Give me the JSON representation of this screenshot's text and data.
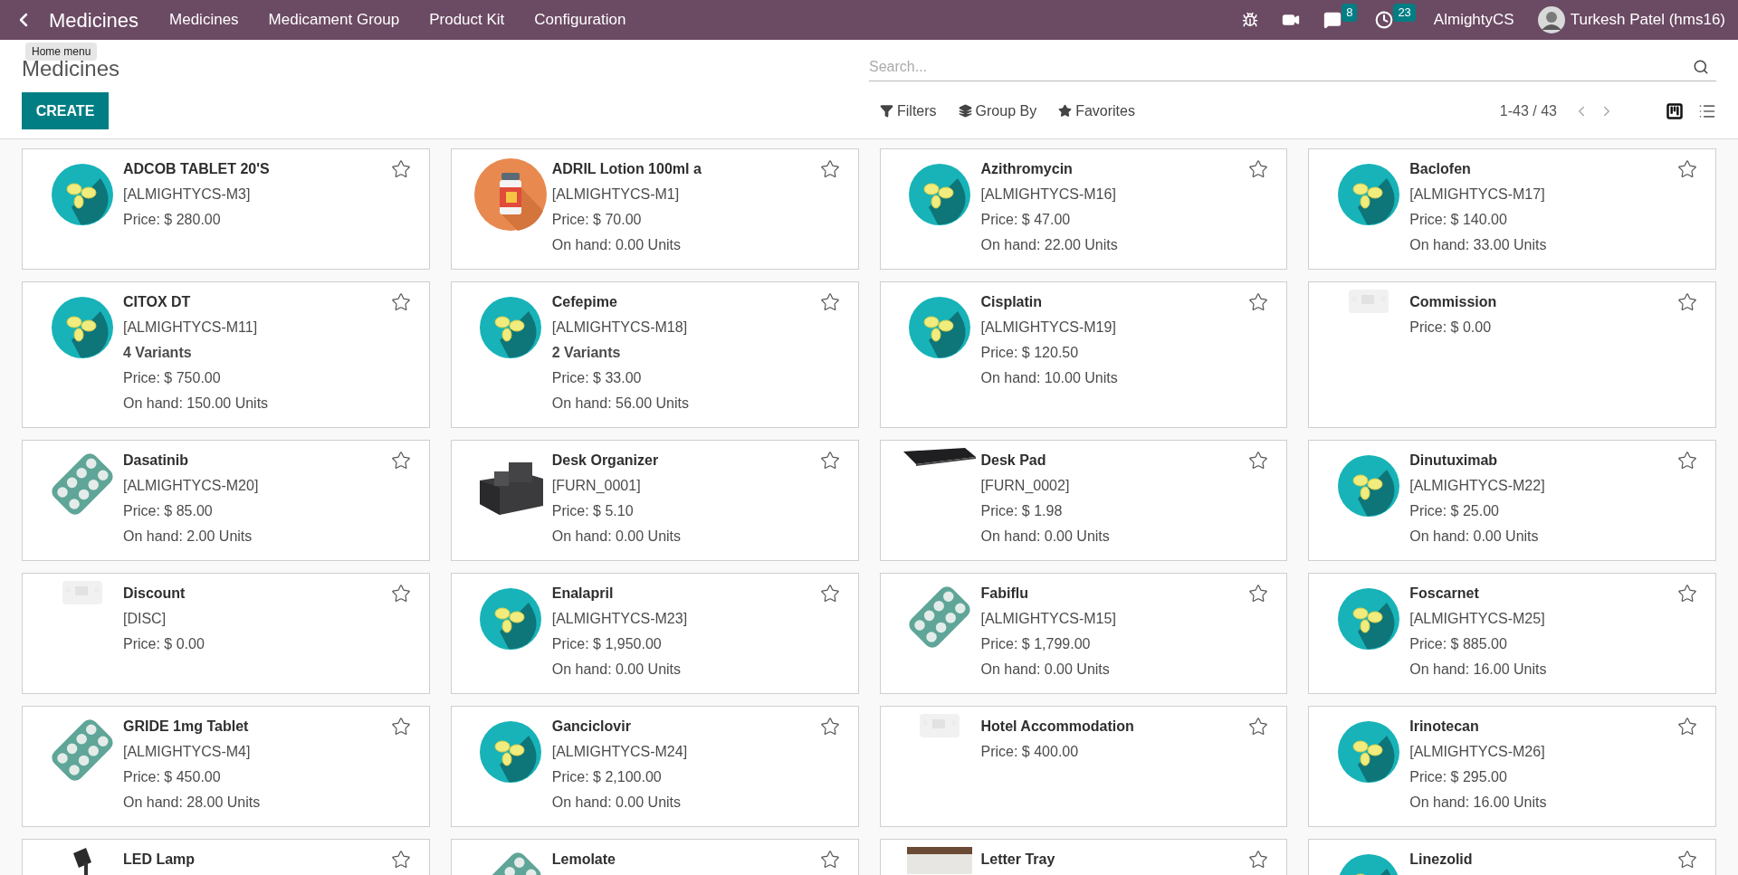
{
  "navbar": {
    "app_title": "Medicines",
    "menus": [
      "Medicines",
      "Medicament Group",
      "Product Kit",
      "Configuration"
    ],
    "messages_badge": "8",
    "activities_badge": "23",
    "company": "AlmightyCS",
    "user": "Turkesh Patel (hms16)"
  },
  "tooltip": "Home menu",
  "breadcrumb": "Medicines",
  "create_button": "CREATE",
  "search": {
    "placeholder": "Search..."
  },
  "filters": [
    {
      "kind": "filter",
      "label": "Filters"
    },
    {
      "kind": "group",
      "label": "Group By"
    },
    {
      "kind": "favorite",
      "label": "Favorites"
    }
  ],
  "pager": "1-43 / 43",
  "views": [
    {
      "kind": "kanban",
      "selected": true
    },
    {
      "kind": "list",
      "selected": false
    }
  ],
  "cards": [
    {
      "name": "ADCOB TABLET 20'S",
      "kind": "pills",
      "favorite": false,
      "code": "[ALMIGHTYCS-M3]",
      "price": "Price: $ 280.00"
    },
    {
      "name": "ADRIL Lotion 100ml a",
      "kind": "bottle",
      "favorite": false,
      "code": "[ALMIGHTYCS-M1]",
      "price": "Price: $ 70.00",
      "on_hand": "On hand: 0.00 Units"
    },
    {
      "name": "Azithromycin",
      "kind": "pills",
      "favorite": false,
      "code": "[ALMIGHTYCS-M16]",
      "price": "Price: $ 47.00",
      "on_hand": "On hand: 22.00 Units"
    },
    {
      "name": "Baclofen",
      "kind": "pills",
      "favorite": false,
      "code": "[ALMIGHTYCS-M17]",
      "price": "Price: $ 140.00",
      "on_hand": "On hand: 33.00 Units"
    },
    {
      "name": "CITOX DT",
      "kind": "pills",
      "favorite": false,
      "code": "[ALMIGHTYCS-M11]",
      "variants": "4 Variants",
      "price": "Price: $ 750.00",
      "on_hand": "On hand: 150.00 Units"
    },
    {
      "name": "Cefepime",
      "kind": "pills",
      "favorite": false,
      "code": "[ALMIGHTYCS-M18]",
      "variants": "2 Variants",
      "price": "Price: $ 33.00",
      "on_hand": "On hand: 56.00 Units"
    },
    {
      "name": "Cisplatin",
      "kind": "pills",
      "favorite": false,
      "code": "[ALMIGHTYCS-M19]",
      "price": "Price: $ 120.50",
      "on_hand": "On hand: 10.00 Units"
    },
    {
      "name": "Commission",
      "kind": "placeholder",
      "favorite": false,
      "price": "Price: $ 0.00"
    },
    {
      "name": "Dasatinib",
      "kind": "blister",
      "favorite": false,
      "code": "[ALMIGHTYCS-M20]",
      "price": "Price: $ 85.00",
      "on_hand": "On hand: 2.00 Units"
    },
    {
      "name": "Desk Organizer",
      "kind": "organizer",
      "favorite": false,
      "code": "[FURN_0001]",
      "price": "Price: $ 5.10",
      "on_hand": "On hand: 0.00 Units"
    },
    {
      "name": "Desk Pad",
      "kind": "pad",
      "favorite": false,
      "code": "[FURN_0002]",
      "price": "Price: $ 1.98",
      "on_hand": "On hand: 0.00 Units"
    },
    {
      "name": "Dinutuximab",
      "kind": "pills",
      "favorite": false,
      "code": "[ALMIGHTYCS-M22]",
      "price": "Price: $ 25.00",
      "on_hand": "On hand: 0.00 Units"
    },
    {
      "name": "Discount",
      "kind": "placeholder",
      "favorite": false,
      "code": "[DISC]",
      "price": "Price: $ 0.00"
    },
    {
      "name": "Enalapril",
      "kind": "pills",
      "favorite": false,
      "code": "[ALMIGHTYCS-M23]",
      "price": "Price: $ 1,950.00",
      "on_hand": "On hand: 0.00 Units"
    },
    {
      "name": "Fabiflu",
      "kind": "blister",
      "favorite": false,
      "code": "[ALMIGHTYCS-M15]",
      "price": "Price: $ 1,799.00",
      "on_hand": "On hand: 0.00 Units"
    },
    {
      "name": "Foscarnet",
      "kind": "pills",
      "favorite": false,
      "code": "[ALMIGHTYCS-M25]",
      "price": "Price: $ 885.00",
      "on_hand": "On hand: 16.00 Units"
    },
    {
      "name": "GRIDE 1mg Tablet",
      "kind": "blister",
      "favorite": false,
      "code": "[ALMIGHTYCS-M4]",
      "price": "Price: $ 450.00",
      "on_hand": "On hand: 28.00 Units"
    },
    {
      "name": "Ganciclovir",
      "kind": "pills",
      "favorite": false,
      "code": "[ALMIGHTYCS-M24]",
      "price": "Price: $ 2,100.00",
      "on_hand": "On hand: 0.00 Units"
    },
    {
      "name": "Hotel Accommodation",
      "kind": "placeholder",
      "favorite": false,
      "price": "Price: $ 400.00"
    },
    {
      "name": "Irinotecan",
      "kind": "pills",
      "favorite": false,
      "code": "[ALMIGHTYCS-M26]",
      "price": "Price: $ 295.00",
      "on_hand": "On hand: 16.00 Units"
    },
    {
      "name": "LED Lamp",
      "kind": "lamp",
      "favorite": false
    },
    {
      "name": "Lemolate",
      "kind": "blister",
      "favorite": false
    },
    {
      "name": "Letter Tray",
      "kind": "tray",
      "favorite": false
    },
    {
      "name": "Linezolid",
      "kind": "pills",
      "favorite": false
    }
  ]
}
